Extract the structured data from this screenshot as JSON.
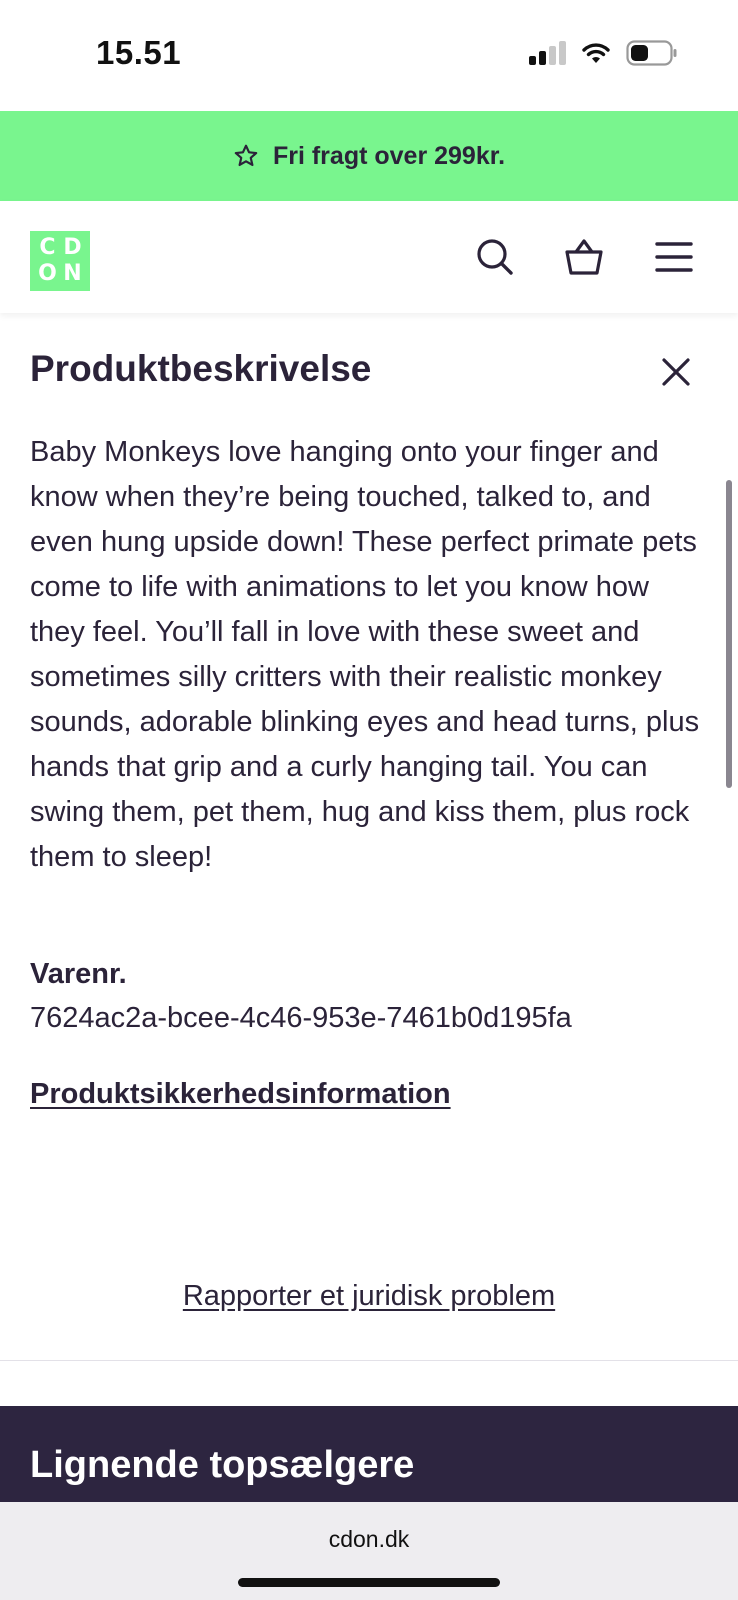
{
  "status_bar": {
    "time": "15.51",
    "icons": [
      "cellular-signal-icon",
      "wifi-icon",
      "battery-icon"
    ]
  },
  "promo": {
    "icon": "star-outline-icon",
    "text": "Fri fragt over 299kr."
  },
  "header": {
    "logo_letters": [
      "C",
      "D",
      "O",
      "N"
    ],
    "icons": [
      "search-icon",
      "basket-icon",
      "hamburger-menu-icon"
    ]
  },
  "product_description": {
    "title": "Produktbeskrivelse",
    "close_icon": "close-icon",
    "body": "Baby Monkeys love hanging onto your finger and know when they’re being touched, talked to, and even hung upside down! These perfect primate pets come to life with animations to let you know how they feel. You’ll fall in love with these sweet and sometimes silly critters with their realistic monkey sounds, adorable blinking eyes and head turns, plus hands that grip and a curly hanging tail. You can swing them, pet them, hug and kiss them, plus rock them to sleep!",
    "sku_label": "Varenr.",
    "sku_value": "7624ac2a-bcee-4c46-953e-7461b0d195fa",
    "safety_link": "Produktsikkerhedsinformation"
  },
  "report_link": "Rapporter et juridisk problem",
  "similar_section": {
    "title": "Lignende topsælgere"
  },
  "browser": {
    "url": "cdon.dk"
  },
  "colors": {
    "brand_green": "#79f58e",
    "dark_purple": "#2d2540",
    "text": "#2b2339"
  }
}
